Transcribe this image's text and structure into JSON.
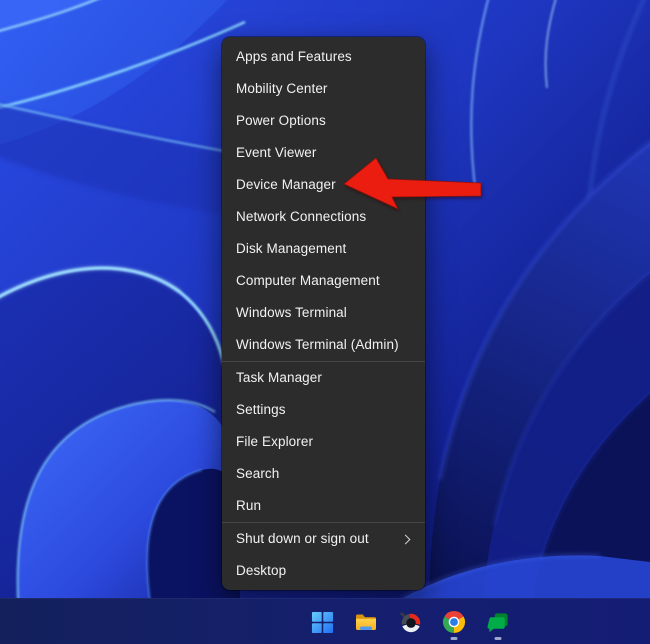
{
  "context_menu": {
    "items": [
      {
        "label": "Apps and Features"
      },
      {
        "label": "Mobility Center"
      },
      {
        "label": "Power Options"
      },
      {
        "label": "Event Viewer"
      },
      {
        "label": "Device Manager"
      },
      {
        "label": "Network Connections"
      },
      {
        "label": "Disk Management"
      },
      {
        "label": "Computer Management"
      },
      {
        "label": "Windows Terminal"
      },
      {
        "label": "Windows Terminal (Admin)"
      },
      {
        "label": "Task Manager"
      },
      {
        "label": "Settings"
      },
      {
        "label": "File Explorer"
      },
      {
        "label": "Search"
      },
      {
        "label": "Run"
      },
      {
        "label": "Shut down or sign out",
        "has_submenu": true
      },
      {
        "label": "Desktop"
      }
    ],
    "separators_after": [
      "Windows Terminal (Admin)",
      "Run"
    ],
    "colors": {
      "background": "#2c2c2c",
      "text": "#f2f2f2",
      "separator": "#444548"
    }
  },
  "annotation_arrow": {
    "color": "#ea1d10",
    "direction": "left",
    "points_to": "Device Manager"
  },
  "taskbar": {
    "background": "#14206a",
    "icons": [
      {
        "name": "start",
        "label": "Start",
        "running": false
      },
      {
        "name": "file-explorer",
        "label": "File Explorer",
        "running": false
      },
      {
        "name": "ring-app",
        "label": "Ring app (red/white ring logo)",
        "running": false
      },
      {
        "name": "chrome",
        "label": "Google Chrome",
        "running": true
      },
      {
        "name": "chat",
        "label": "Google Chat",
        "running": true
      }
    ]
  },
  "wallpaper": {
    "name": "Windows 11 blue bloom",
    "dominant_colors": [
      "#2a4ce6",
      "#1e36c0",
      "#0a1258",
      "#8fdcff"
    ]
  }
}
